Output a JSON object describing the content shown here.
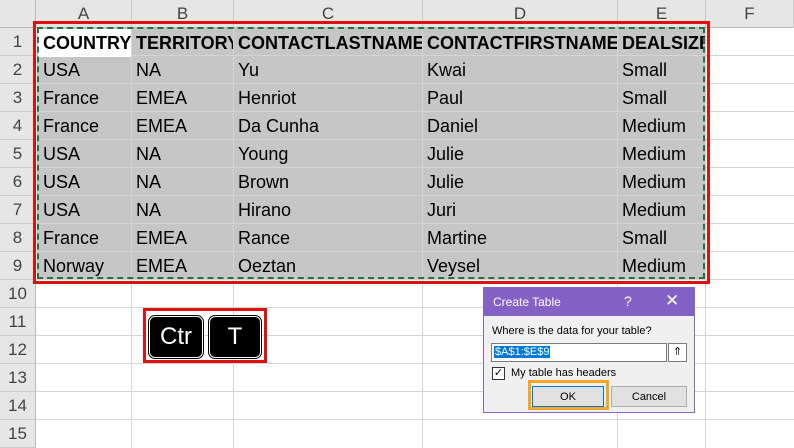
{
  "columns": [
    "A",
    "B",
    "C",
    "D",
    "E",
    "F"
  ],
  "rows": [
    "1",
    "2",
    "3",
    "4",
    "5",
    "6",
    "7",
    "8",
    "9",
    "10",
    "11",
    "12",
    "13",
    "14",
    "15"
  ],
  "table": {
    "headers": [
      "COUNTRY",
      "TERRITORY",
      "CONTACTLASTNAME",
      "CONTACTFIRSTNAME",
      "DEALSIZE"
    ],
    "data": [
      [
        "USA",
        "NA",
        "Yu",
        "Kwai",
        "Small"
      ],
      [
        "France",
        "EMEA",
        "Henriot",
        "Paul",
        "Small"
      ],
      [
        "France",
        "EMEA",
        "Da Cunha",
        "Daniel",
        "Medium"
      ],
      [
        "USA",
        "NA",
        "Young",
        "Julie",
        "Medium"
      ],
      [
        "USA",
        "NA",
        "Brown",
        "Julie",
        "Medium"
      ],
      [
        "USA",
        "NA",
        "Hirano",
        "Juri",
        "Medium"
      ],
      [
        "France",
        "EMEA",
        "Rance",
        "Martine",
        "Small"
      ],
      [
        "Norway",
        "EMEA",
        "Oeztan",
        "Veysel",
        "Medium"
      ]
    ]
  },
  "shortcut": {
    "key1": "Ctr",
    "key2": "T"
  },
  "dialog": {
    "title": "Create Table",
    "help": "?",
    "close": "✕",
    "prompt": "Where is the data for your table?",
    "range": "$A$1:$E$9",
    "ref_icon": "⇑",
    "checkbox_checked": true,
    "checkbox_label": "My table has headers",
    "ok": "OK",
    "cancel": "Cancel"
  },
  "colors": {
    "highlight_red": "#e01010",
    "highlight_orange": "#f5a623",
    "dialog_accent": "#8461c4",
    "marquee": "#217346"
  }
}
